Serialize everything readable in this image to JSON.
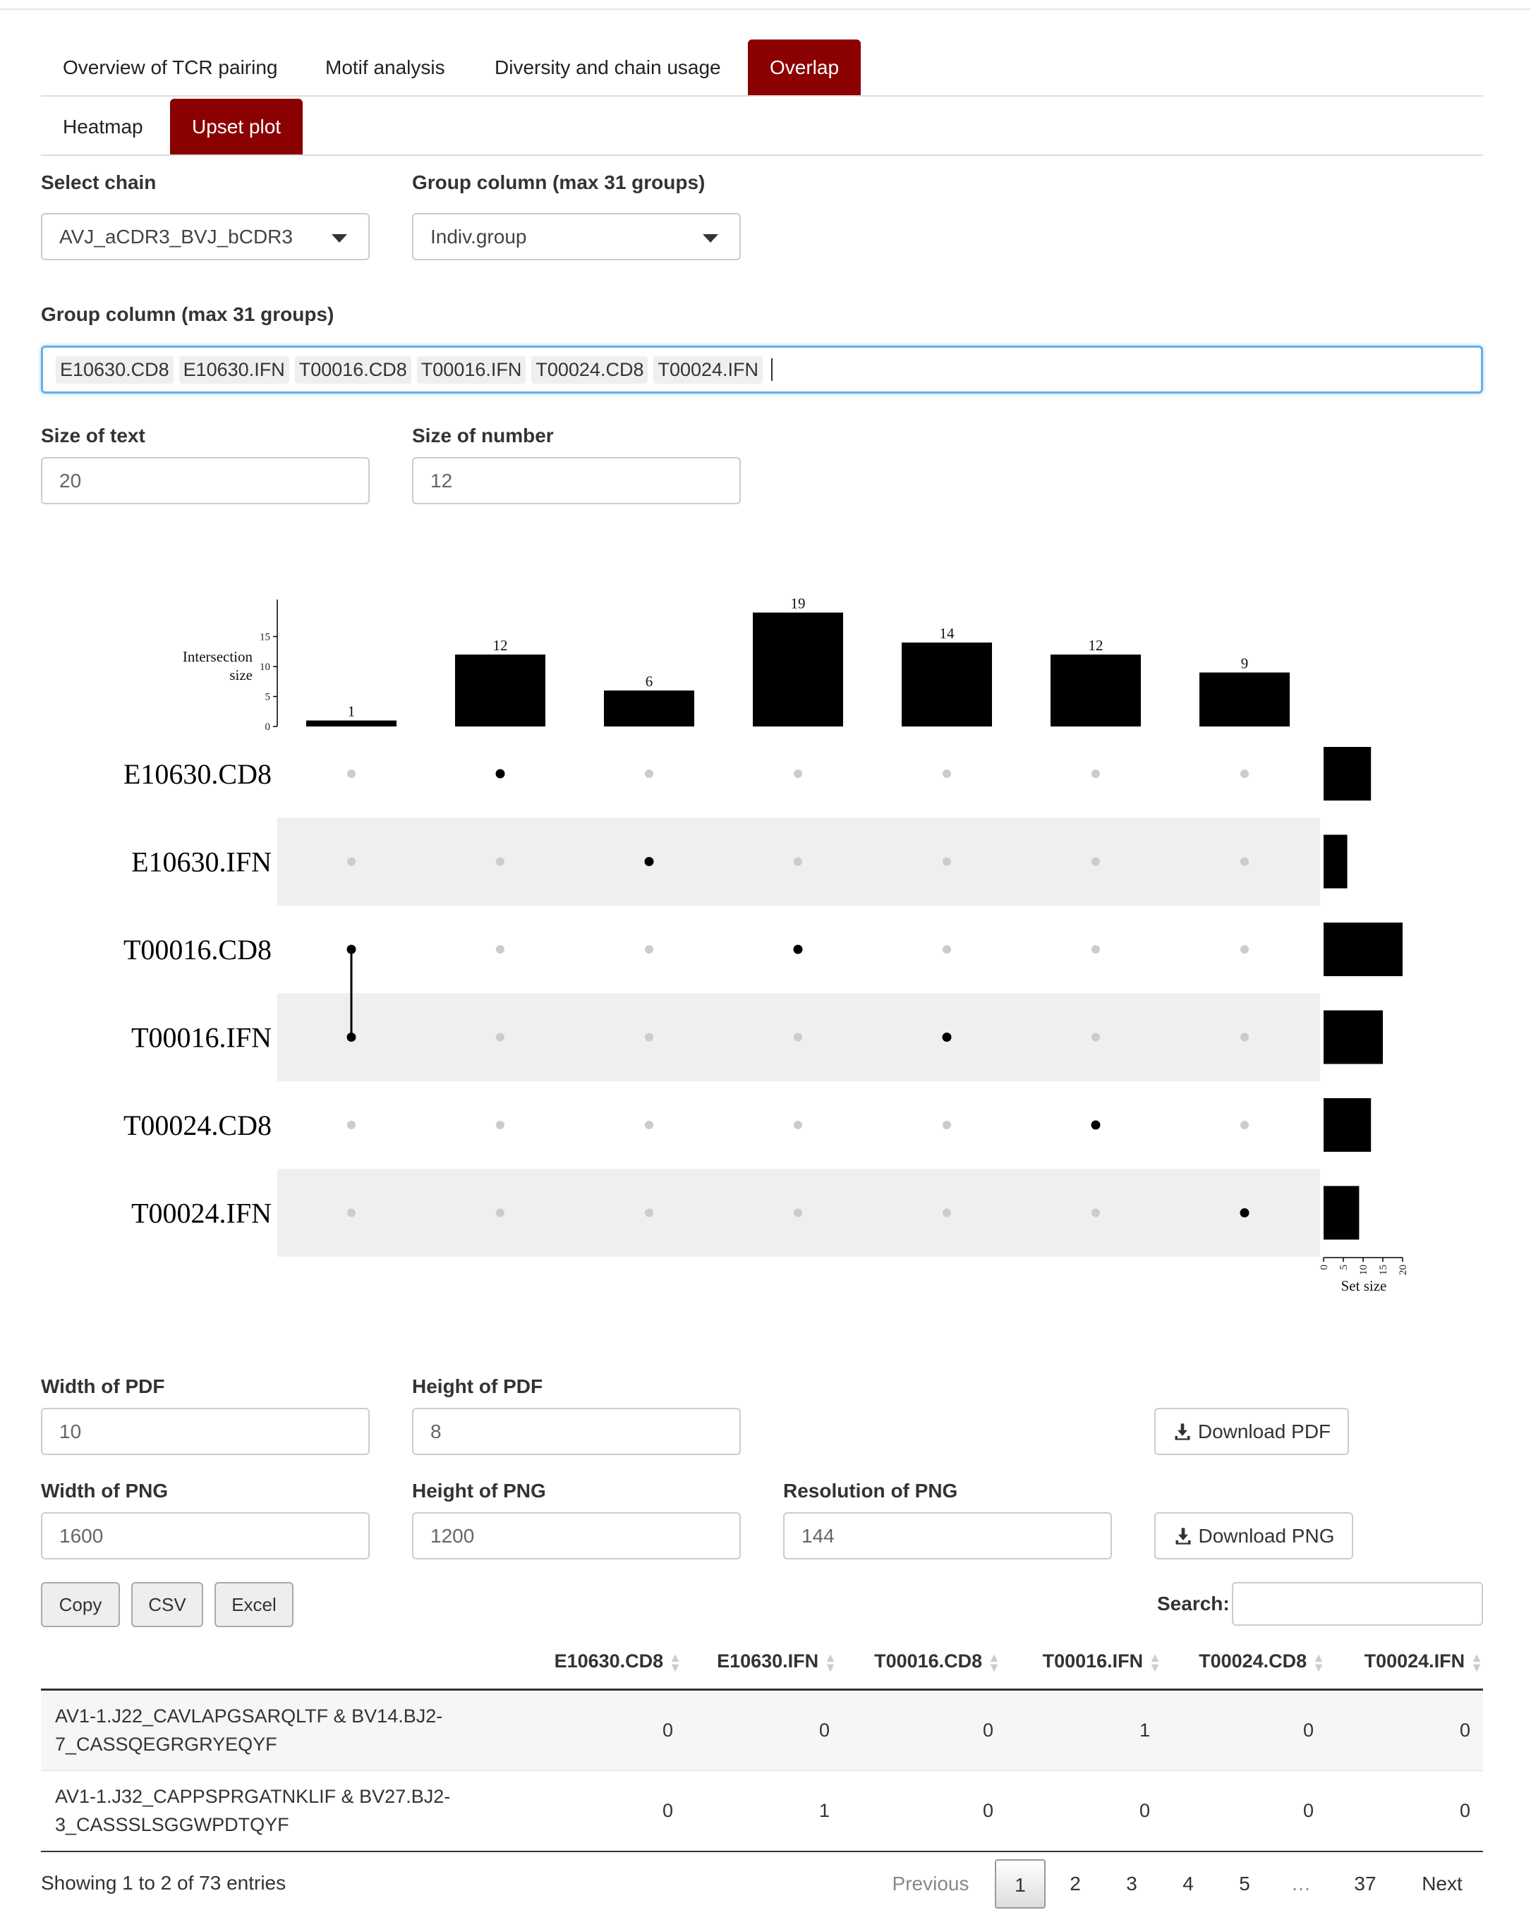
{
  "tabs": [
    "Overview of TCR pairing",
    "Motif analysis",
    "Diversity and chain usage",
    "Overlap"
  ],
  "subtabs": [
    "Heatmap",
    "Upset plot"
  ],
  "form": {
    "select_chain_label": "Select chain",
    "select_chain_value": "AVJ_aCDR3_BVJ_bCDR3",
    "group_col_label": "Group column (max 31 groups)",
    "group_col_value": "Indiv.group",
    "group_col2_label": "Group column (max 31 groups)",
    "chips": [
      "E10630.CD8",
      "E10630.IFN",
      "T00016.CD8",
      "T00016.IFN",
      "T00024.CD8",
      "T00024.IFN"
    ],
    "text_size_label": "Size of text",
    "text_size_value": "20",
    "num_size_label": "Size of number",
    "num_size_value": "12"
  },
  "chart_data": {
    "type": "upset",
    "sets": [
      "E10630.CD8",
      "E10630.IFN",
      "T00016.CD8",
      "T00016.IFN",
      "T00024.CD8",
      "T00024.IFN"
    ],
    "intersections": [
      {
        "members": [
          "T00016.CD8",
          "T00016.IFN"
        ],
        "size": 1
      },
      {
        "members": [
          "E10630.CD8"
        ],
        "size": 12
      },
      {
        "members": [
          "E10630.IFN"
        ],
        "size": 6
      },
      {
        "members": [
          "T00016.CD8"
        ],
        "size": 19
      },
      {
        "members": [
          "T00016.IFN"
        ],
        "size": 14
      },
      {
        "members": [
          "T00024.CD8"
        ],
        "size": 12
      },
      {
        "members": [
          "T00024.IFN"
        ],
        "size": 9
      }
    ],
    "set_sizes": [
      12,
      6,
      20,
      15,
      12,
      9
    ],
    "ylabel_line1": "Intersection",
    "ylabel_line2": "size",
    "yticks": [
      0,
      5,
      10,
      15
    ],
    "ylim": [
      0,
      20
    ],
    "set_size_label": "Set size",
    "set_size_ticks": [
      0,
      5,
      10,
      15,
      20
    ]
  },
  "export": {
    "pdf_width_label": "Width of PDF",
    "pdf_width_value": "10",
    "pdf_height_label": "Height of PDF",
    "pdf_height_value": "8",
    "download_pdf": "Download PDF",
    "png_width_label": "Width of PNG",
    "png_width_value": "1600",
    "png_height_label": "Height of PNG",
    "png_height_value": "1200",
    "png_res_label": "Resolution of PNG",
    "png_res_value": "144",
    "download_png": "Download PNG"
  },
  "table": {
    "buttons": [
      "Copy",
      "CSV",
      "Excel"
    ],
    "search_label": "Search:",
    "columns": [
      "E10630.CD8",
      "E10630.IFN",
      "T00016.CD8",
      "T00016.IFN",
      "T00024.CD8",
      "T00024.IFN"
    ],
    "rows": [
      {
        "name_line1": "AV1-1.J22_CAVLAPGSARQLTF & BV14.BJ2-",
        "name_line2": "7_CASSQEGRGRYEQYF",
        "values": [
          "0",
          "0",
          "0",
          "1",
          "0",
          "0"
        ]
      },
      {
        "name_line1": "AV1-1.J32_CAPPSPRGATNKLIF & BV27.BJ2-",
        "name_line2": "3_CASSSLSGGWPDTQYF",
        "values": [
          "0",
          "1",
          "0",
          "0",
          "0",
          "0"
        ]
      }
    ],
    "info": "Showing 1 to 2 of 73 entries",
    "pagination": [
      "Previous",
      "1",
      "2",
      "3",
      "4",
      "5",
      "…",
      "37",
      "Next"
    ]
  }
}
